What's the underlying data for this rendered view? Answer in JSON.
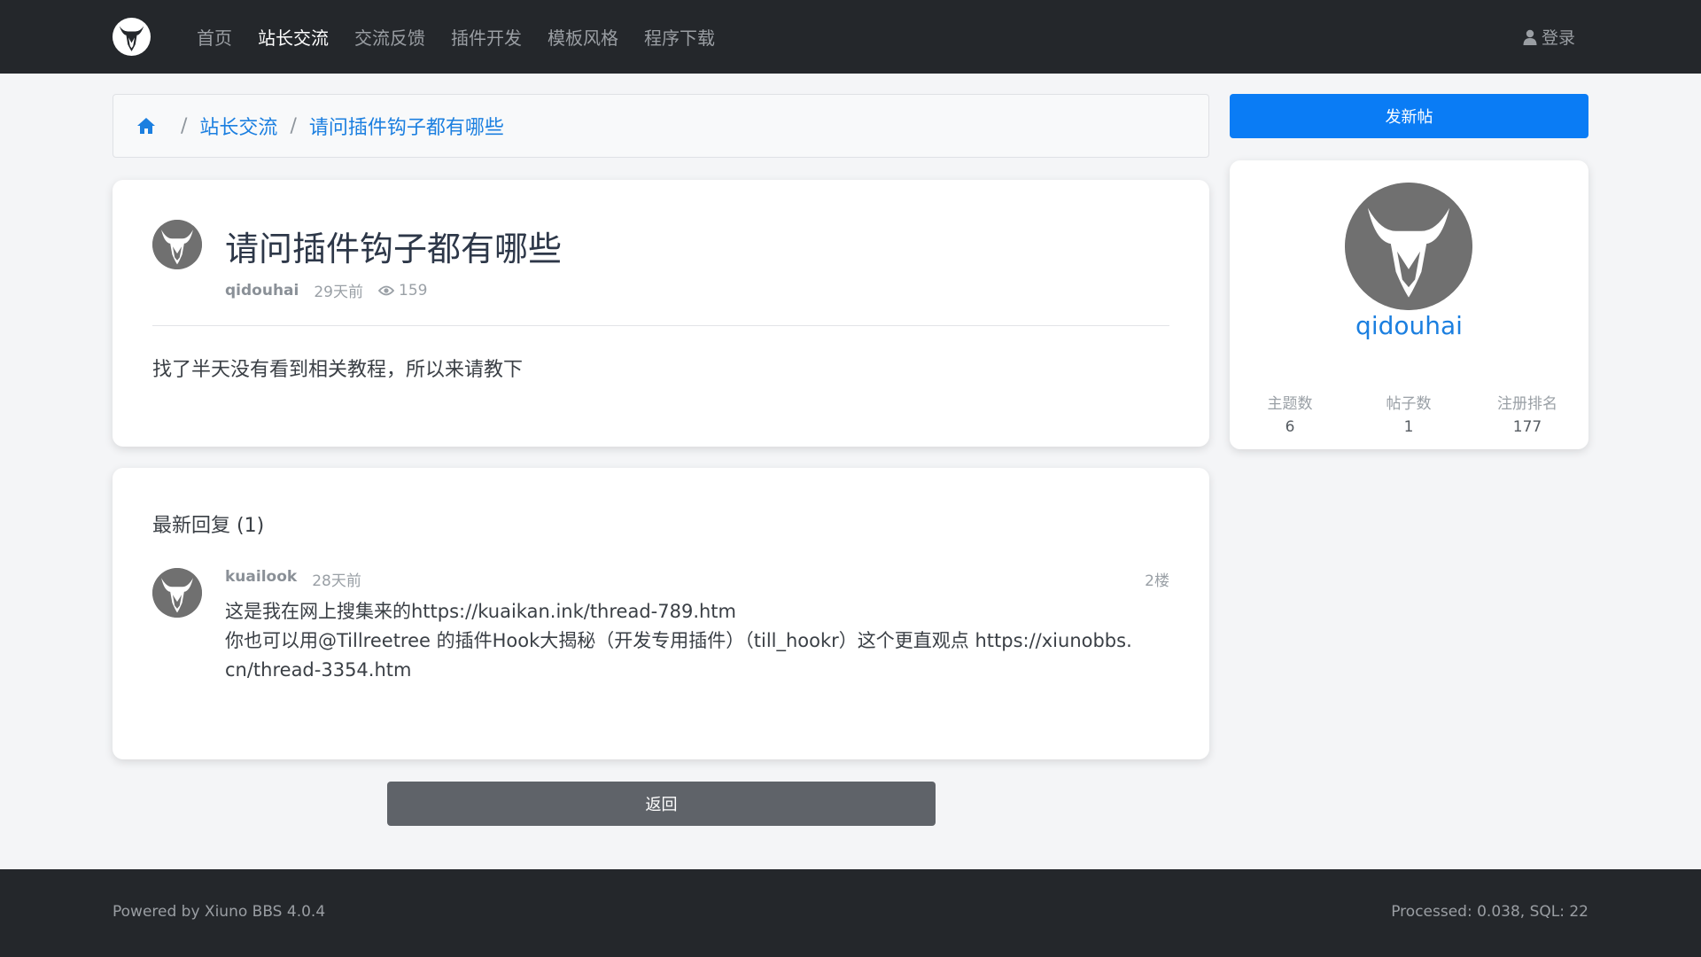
{
  "nav": {
    "links": [
      {
        "label": "首页",
        "active": false
      },
      {
        "label": "站长交流",
        "active": true
      },
      {
        "label": "交流反馈",
        "active": false
      },
      {
        "label": "插件开发",
        "active": false
      },
      {
        "label": "模板风格",
        "active": false
      },
      {
        "label": "程序下载",
        "active": false
      }
    ],
    "login_label": "登录",
    "logo_icon": "bull-head-logo-icon"
  },
  "breadcrumb": {
    "home_icon": "home-icon",
    "items": [
      "站长交流",
      "请问插件钩子都有哪些"
    ]
  },
  "post": {
    "title": "请问插件钩子都有哪些",
    "author": "qidouhai",
    "time": "29天前",
    "views": "159",
    "body": "找了半天没有看到相关教程，所以来请教下"
  },
  "replies": {
    "heading": "最新回复 (1)",
    "items": [
      {
        "author": "kuailook",
        "time": "28天前",
        "floor": "2楼",
        "lines": [
          "这是我在网上搜集来的https://kuaikan.ink/thread-789.htm",
          "你也可以用@Tillreetree  的插件Hook大揭秘（开发专用插件）（till_hookr）这个更直观点  https://xiunobbs.",
          "cn/thread-3354.htm"
        ]
      }
    ]
  },
  "back_label": "返回",
  "sidebar": {
    "new_post_label": "发新帖",
    "user": {
      "name": "qidouhai",
      "stats": [
        {
          "label": "主题数",
          "value": "6"
        },
        {
          "label": "帖子数",
          "value": "1"
        },
        {
          "label": "注册排名",
          "value": "177"
        }
      ]
    }
  },
  "footer": {
    "left": "Powered by Xiuno BBS 4.0.4",
    "right": "Processed: 0.038, SQL: 22"
  },
  "colors": {
    "navbar_bg": "#24272b",
    "accent": "#0a7cf5",
    "link": "#1b7fe0",
    "back_button": "#5f6369"
  }
}
